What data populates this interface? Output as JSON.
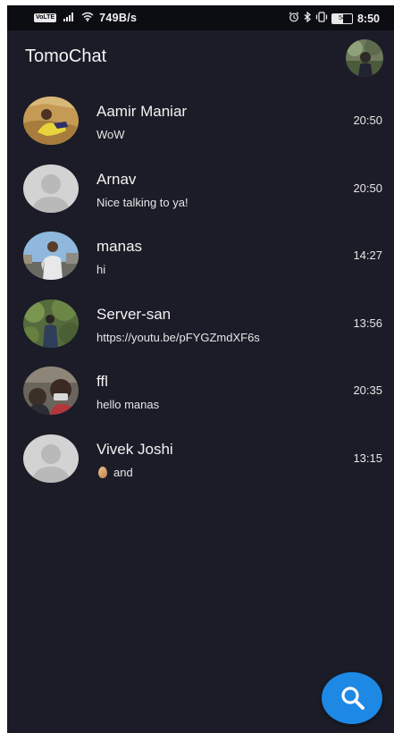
{
  "status_bar": {
    "volte": "VoLTE",
    "net_speed": "749B/s",
    "battery_level": "54",
    "time": "8:50",
    "icons": [
      "signal-icon",
      "wifi-icon",
      "alarm-icon",
      "bluetooth-icon",
      "vibrate-icon",
      "battery-icon"
    ]
  },
  "app_bar": {
    "title": "TomoChat",
    "profile_avatar": "profile-photo"
  },
  "chats": [
    {
      "name": "Aamir Maniar",
      "preview": "WoW",
      "time": "20:50",
      "avatar": "photo-sandy-outdoor"
    },
    {
      "name": "Arnav",
      "preview": "Nice talking to ya!",
      "time": "20:50",
      "avatar": "default-avatar"
    },
    {
      "name": "manas",
      "preview": "hi",
      "time": "14:27",
      "avatar": "photo-city-sky"
    },
    {
      "name": "Server-san",
      "preview": "https://youtu.be/pFYGZmdXF6s",
      "time": "13:56",
      "avatar": "photo-greenery"
    },
    {
      "name": "ffl",
      "preview": "hello manas",
      "time": "20:35",
      "avatar": "photo-group-selfie"
    },
    {
      "name": "Vivek Joshi",
      "preview": "and",
      "preview_icon": "egg-emoji-icon",
      "time": "13:15",
      "avatar": "default-avatar"
    }
  ],
  "fab": {
    "icon": "search-icon"
  },
  "colors": {
    "background": "#1b1c27",
    "status_bar": "#0c0d12",
    "text": "#f2f2f2",
    "accent": "#1e88e5"
  }
}
